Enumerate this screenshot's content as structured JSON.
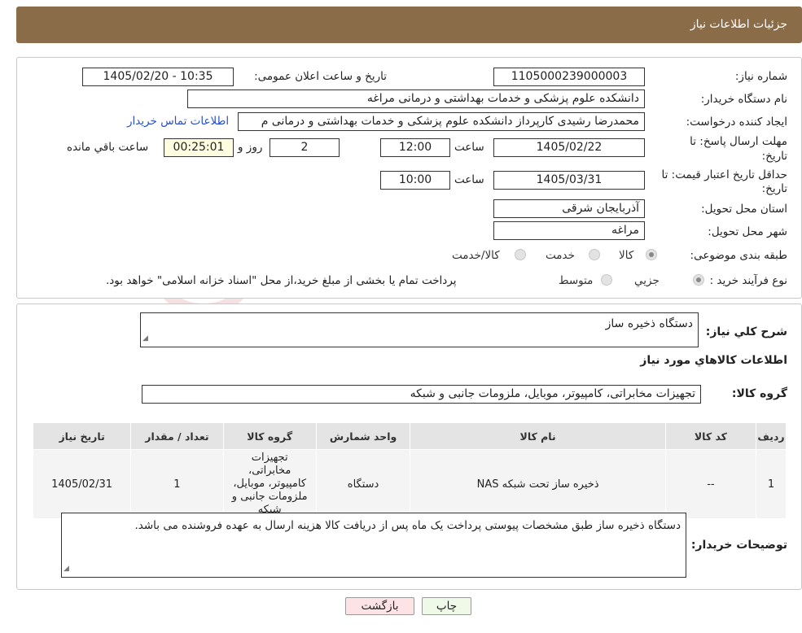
{
  "header": {
    "title": "جزئیات اطلاعات نیاز"
  },
  "form": {
    "need_number_label": "شماره نیاز:",
    "need_number": "1105000239000003",
    "announce_label": "تاریخ و ساعت اعلان عمومی:",
    "announce_value": "1405/02/20 - 10:35",
    "buyer_label": "نام دستگاه خریدار:",
    "buyer_value": "دانشکده علوم پزشکی و خدمات بهداشتی و درمانی مراغه",
    "requester_label": "ایجاد کننده درخواست:",
    "requester_value": "محمدرضا رشیدی کارپرداز دانشکده علوم پزشکی و خدمات بهداشتی و درمانی م",
    "contact_link": "اطلاعات تماس خریدار",
    "deadline_label_1": "مهلت ارسال پاسخ: تا",
    "deadline_label_2": "تاریخ:",
    "deadline_date": "1405/02/22",
    "hour_label": "ساعت",
    "deadline_time": "12:00",
    "days_value": "2",
    "days_label": "روز و",
    "remaining_value": "00:25:01",
    "remaining_label": "ساعت باقي مانده",
    "validity_label_1": "حداقل تاریخ اعتبار قیمت: تا",
    "validity_label_2": "تاریخ:",
    "validity_date": "1405/03/31",
    "validity_time": "10:00",
    "province_label": "استان محل تحویل:",
    "province_value": "آذربایجان شرقی",
    "city_label": "شهر محل تحویل:",
    "city_value": "مراغه",
    "category_label": "طبقه بندی موضوعی:",
    "category_options": [
      "کالا",
      "خدمت",
      "کالا/خدمت"
    ],
    "process_label": "نوع فرآیند خرید :",
    "process_options": [
      "جزیي",
      "متوسط"
    ],
    "process_note": "پرداخت تمام یا بخشی از مبلغ خرید،از محل \"اسناد خزانه اسلامی\" خواهد بود."
  },
  "summary": {
    "description_label": "شرح کلي نیاز:",
    "description_value": "دستگاه ذخیره ساز",
    "goods_info_title": "اطلاعات کالاهاي مورد نیاز",
    "group_label": "گروه کالا:",
    "group_value": "تجهیزات مخابراتی، کامپیوتر، موبایل، ملزومات جانبی و شبکه"
  },
  "table": {
    "headers": [
      "ردیف",
      "کد کالا",
      "نام کالا",
      "واحد شمارش",
      "گروه کالا",
      "تعداد / مقدار",
      "تاریخ نیاز"
    ],
    "row": {
      "index": "1",
      "code": "--",
      "name": "ذخیره ساز تحت شبکه NAS",
      "unit": "دستگاه",
      "group": "تجهیزات مخابراتی، کامپیوتر، موبایل، ملزومات جانبی و شبکه",
      "qty": "1",
      "date": "1405/02/31"
    }
  },
  "buyer_notes": {
    "label": "توضیحات خریدار:",
    "value": "دستگاه ذخیره ساز طبق مشخصات پیوستی پرداخت یک ماه پس از دریافت کالا هزینه ارسال به عهده فروشنده می باشد."
  },
  "buttons": {
    "print": "چاپ",
    "back": "بازگشت"
  },
  "colors": {
    "header": "#8b6c49",
    "link": "#2a50c8",
    "back_button": "#fde3e6",
    "print_button": "#eef9e8"
  },
  "watermark": "AriaTender.neT"
}
